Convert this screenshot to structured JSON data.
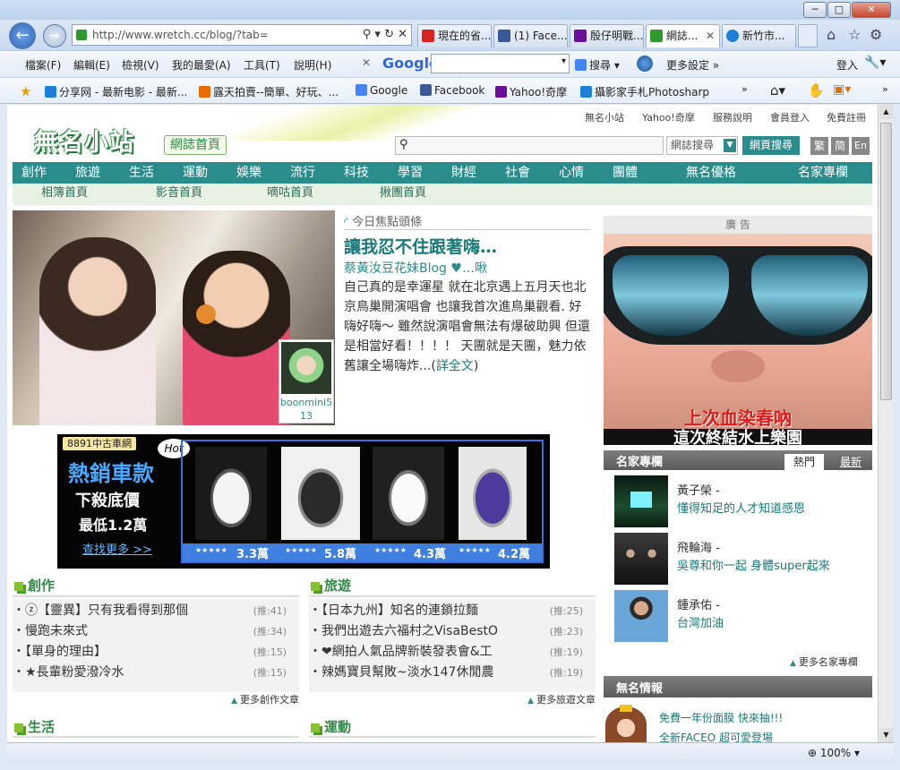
{
  "browser": {
    "window_buttons": [
      "─",
      "□",
      "✕"
    ],
    "url": "http://www.wretch.cc/blog/?tab=",
    "tabs": [
      {
        "label": "現在的省...",
        "color": "#d22"
      },
      {
        "label": "(1) Face...",
        "color": "#3b5998"
      },
      {
        "label": "殷仔明戰...",
        "color": "#6b0f9a"
      },
      {
        "label": "網誌...",
        "color": "#2e9a2e"
      },
      {
        "label": "新竹市...",
        "color": "#1e7fd8"
      }
    ],
    "menus": [
      "檔案(F)",
      "編輯(E)",
      "檢視(V)",
      "我的最愛(A)",
      "工具(T)",
      "說明(H)"
    ],
    "google_label": "Google",
    "search_label": "搜尋",
    "more_settings": "更多設定 »",
    "login": "登入",
    "favorites": [
      "分享网 - 最新电影 - 最新...",
      "露天拍賣--簡單、好玩、...",
      "Google",
      "Facebook",
      "Yahoo!奇摩",
      "攝影家手札Photosharp"
    ],
    "zoom": "100%"
  },
  "site": {
    "top_links": [
      "無名小站",
      "Yahoo!奇摩",
      "服務說明",
      "會員登入",
      "免費註冊"
    ],
    "logo": "無名小站",
    "logo_sub": "網誌首頁",
    "search_select": "網誌搜尋",
    "search_button": "網頁搜尋",
    "lang": [
      "繁",
      "简",
      "En"
    ],
    "nav": [
      "創作",
      "旅遊",
      "生活",
      "運動",
      "娛樂",
      "流行",
      "科技",
      "學習",
      "財經",
      "社會",
      "心情",
      "團體",
      "無名優格",
      "名家專欄"
    ],
    "subnav": [
      "相簿首頁",
      "影音首頁",
      "嘀咕首頁",
      "揪團首頁"
    ]
  },
  "headline": {
    "label": "今日焦點頭條",
    "title": "讓我忍不住跟著嗨…",
    "blog": "蔡黃汝豆花妹Blog ♥…啾",
    "body": "自己真的是幸運星 就在北京遇上五月天也北京鳥巢開演唱會 也讓我首次進鳥巢觀看. 好嗨好嗨～ 雖然說演唱會無法有爆破助興 但還是相當好看！！！！ 天團就是天團，魅力依舊讓全場嗨炸...(",
    "more": "詳全文",
    "close": ")",
    "thumb_user": "boonmini513"
  },
  "banner": {
    "tag": "8891中古車網",
    "title": "熱銷車款",
    "line1": "下殺底價",
    "line2": "最低1.2萬",
    "cta": "查找更多 >>",
    "hot": "Hot",
    "prices": [
      "3.3萬",
      "5.8萬",
      "4.3萬",
      "4.2萬"
    ],
    "stars": "★★★★★"
  },
  "sections": [
    {
      "title": "創作",
      "items": [
        {
          "text": "ⓩ【靈異】只有我看得到那個",
          "count": "(推:41)"
        },
        {
          "text": "慢跑未來式",
          "count": "(推:34)"
        },
        {
          "text": "【單身的理由】",
          "count": "(推:15)"
        },
        {
          "text": "★長輩粉愛潑冷水",
          "count": "(推:15)"
        }
      ],
      "more": "更多創作文章"
    },
    {
      "title": "旅遊",
      "items": [
        {
          "text": "【日本九州】知名的連鎖拉麵",
          "count": "(推:25)"
        },
        {
          "text": "我們出遊去六福村之VisaBestO",
          "count": "(推:23)"
        },
        {
          "text": "❤網拍人氣品牌新裝發表會&工",
          "count": "(推:19)"
        },
        {
          "text": "辣媽寶貝幫敗~淡水147休閒農",
          "count": "(推:19)"
        }
      ],
      "more": "更多旅遊文章"
    }
  ],
  "section_titles_row2": [
    "生活",
    "運動"
  ],
  "ad": {
    "label": "廣 告",
    "text1": "上次血染春吶",
    "text2": "這次終結水上樂園"
  },
  "columns": {
    "title": "名家專欄",
    "tabs": [
      "熱門",
      "最新"
    ],
    "items": [
      {
        "name": "黃子榮 -",
        "desc": "懂得知足的人才知道感恩"
      },
      {
        "name": "飛輪海 -",
        "desc": "吳尊和你一起 身體super起來"
      },
      {
        "name": "鍾承佑 -",
        "desc": "台灣加油"
      }
    ],
    "more": "更多名家專欄"
  },
  "info": {
    "title": "無名情報",
    "line1": "免費一年份面膜 快來抽!!!",
    "line2": "全新FACEO 超可愛登場"
  }
}
